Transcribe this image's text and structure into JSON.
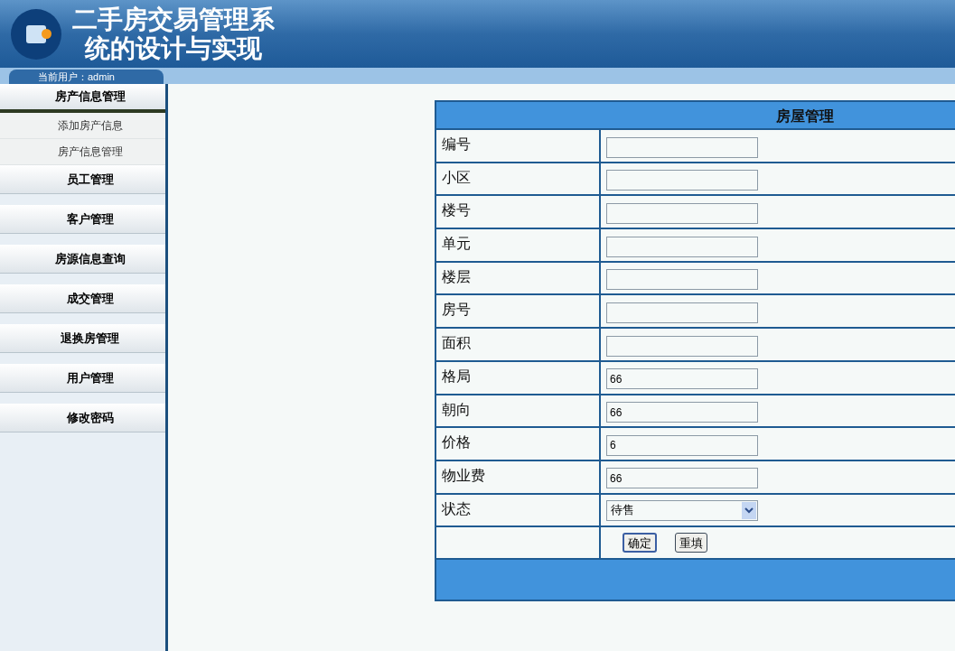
{
  "header": {
    "title_lines": [
      "二手房交易管理系",
      "统的设计与实现"
    ],
    "user_label": "当前用户：admin"
  },
  "sidebar": {
    "menus": [
      {
        "label": "房产信息管理",
        "expanded": true,
        "children": [
          {
            "label": "添加房产信息"
          },
          {
            "label": "房产信息管理"
          }
        ]
      },
      {
        "label": "员工管理",
        "expanded": false
      },
      {
        "label": "客户管理",
        "expanded": false
      },
      {
        "label": "房源信息查询",
        "expanded": false
      },
      {
        "label": "成交管理",
        "expanded": false
      },
      {
        "label": "退换房管理",
        "expanded": false
      },
      {
        "label": "用户管理",
        "expanded": false
      },
      {
        "label": "修改密码",
        "expanded": false
      }
    ]
  },
  "form": {
    "title": "房屋管理",
    "fields": [
      {
        "label": "编号",
        "kind": "text"
      },
      {
        "label": "小区",
        "kind": "text"
      },
      {
        "label": "楼号",
        "kind": "text"
      },
      {
        "label": "单元",
        "kind": "text"
      },
      {
        "label": "楼层",
        "kind": "text"
      },
      {
        "label": "房号",
        "kind": "text"
      },
      {
        "label": "面积",
        "kind": "text"
      },
      {
        "label": "格局",
        "kind": "text",
        "value": "66"
      },
      {
        "label": "朝向",
        "kind": "text",
        "value": "66"
      },
      {
        "label": "价格",
        "kind": "text",
        "value": "6"
      },
      {
        "label": "物业费",
        "kind": "text",
        "value": "66"
      },
      {
        "label": "状态",
        "kind": "select",
        "value": "待售"
      }
    ],
    "buttons": [
      "确定",
      "重填"
    ]
  }
}
